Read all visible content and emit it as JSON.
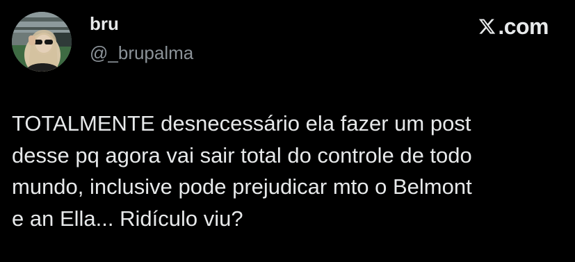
{
  "tweet": {
    "author": {
      "display_name": "bru",
      "handle": "@_brupalma",
      "avatar_icon": "profile-photo"
    },
    "brand": {
      "icon": "x-logo-icon",
      "text": ".com"
    },
    "text_lines": [
      "TOTALMENTE desnecessário ela fazer um post",
      "desse pq agora vai sair total do controle de todo",
      "mundo, inclusive pode prejudicar mto o Belmont",
      "e an Ella... Ridículo viu?"
    ]
  },
  "colors": {
    "background": "#000000",
    "primary_text": "#e7e9ea",
    "secondary_text": "#8b9298"
  }
}
